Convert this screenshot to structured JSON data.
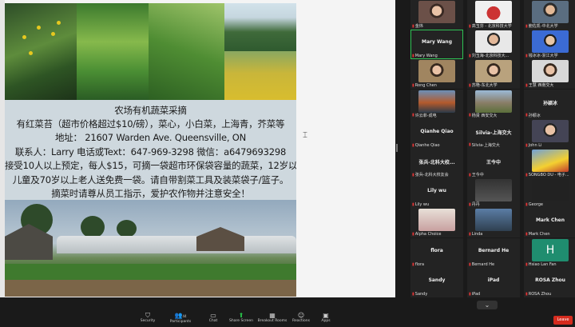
{
  "flyer": {
    "line1": "农场有机蔬菜采摘",
    "line2": "有红菜苔（超市价格超过$10/磅），菜心，小白菜，上海青，芥菜等",
    "line3": "地址：  21607 Warden Ave. Queensville, ON",
    "line4": "联系人：Larry  电话或Text：647-969-3298  微信：a6479693298",
    "line5": "接受10人以上预定，每人$15，可摘一袋超市环保袋容量的蔬菜，12岁以下",
    "line6": "儿童及70岁以上老人送免费一袋。请自带割菜工具及装菜袋子/篮子。",
    "line7": "摘菜时请尊从员工指示，爱护农作物并注意安全！"
  },
  "gallery": [
    {
      "name": "金炜",
      "big": ""
    },
    {
      "name": "高玉芬 - 北京科技大学",
      "big": ""
    },
    {
      "name": "鲍佐凯-中北大学",
      "big": ""
    },
    {
      "name": "Mary Wang",
      "big": "Mary Wang"
    },
    {
      "name": "刘玉海-北京科技大...",
      "big": ""
    },
    {
      "name": "钱冰冰-浙江大学",
      "big": ""
    },
    {
      "name": "Rong Chen",
      "big": ""
    },
    {
      "name": "苏艳-东北大学",
      "big": ""
    },
    {
      "name": "王慧 西南交大",
      "big": ""
    },
    {
      "name": "许云菲-成电",
      "big": ""
    },
    {
      "name": "杨贤 西安交大",
      "big": ""
    },
    {
      "name": "孙颖冰",
      "big": "孙颖冰"
    },
    {
      "name": "Qianhe Qiao",
      "big": "Qianhe Qiao"
    },
    {
      "name": "Silvia-上海交大",
      "big": "Silvia-上海交大"
    },
    {
      "name": "John Li",
      "big": ""
    },
    {
      "name": "张兵-北科大校友会",
      "big": "张兵-北科大校..."
    },
    {
      "name": "王今中",
      "big": "王今中"
    },
    {
      "name": "SONGBO DU - 电子...",
      "big": ""
    },
    {
      "name": "Lily wu",
      "big": "Lily wu"
    },
    {
      "name": "丹丹",
      "big": ""
    },
    {
      "name": "George",
      "big": ""
    },
    {
      "name": "Alpha Choice",
      "big": ""
    },
    {
      "name": "Linda",
      "big": ""
    },
    {
      "name": "Mark Chen",
      "big": "Mark Chen"
    },
    {
      "name": "flora",
      "big": "flora"
    },
    {
      "name": "Bernard He",
      "big": "Bernard He"
    },
    {
      "name": "Hsiao Lan Fan",
      "big": ""
    },
    {
      "name": "Sandy",
      "big": "Sandy"
    },
    {
      "name": "iPad",
      "big": "iPad"
    },
    {
      "name": "ROSA Zhou",
      "big": "ROSA Zhou"
    }
  ],
  "toolbar": {
    "security": "Security",
    "participants": "Participants",
    "participants_count": "44",
    "chat": "Chat",
    "share": "Share Screen",
    "breakout": "Breakout Rooms",
    "reactions": "Reactions",
    "apps": "Apps",
    "leave": "Leave"
  },
  "colors": {
    "accent": "#28c249",
    "leave": "#d52b1e",
    "muted_mic": "#e03535"
  }
}
